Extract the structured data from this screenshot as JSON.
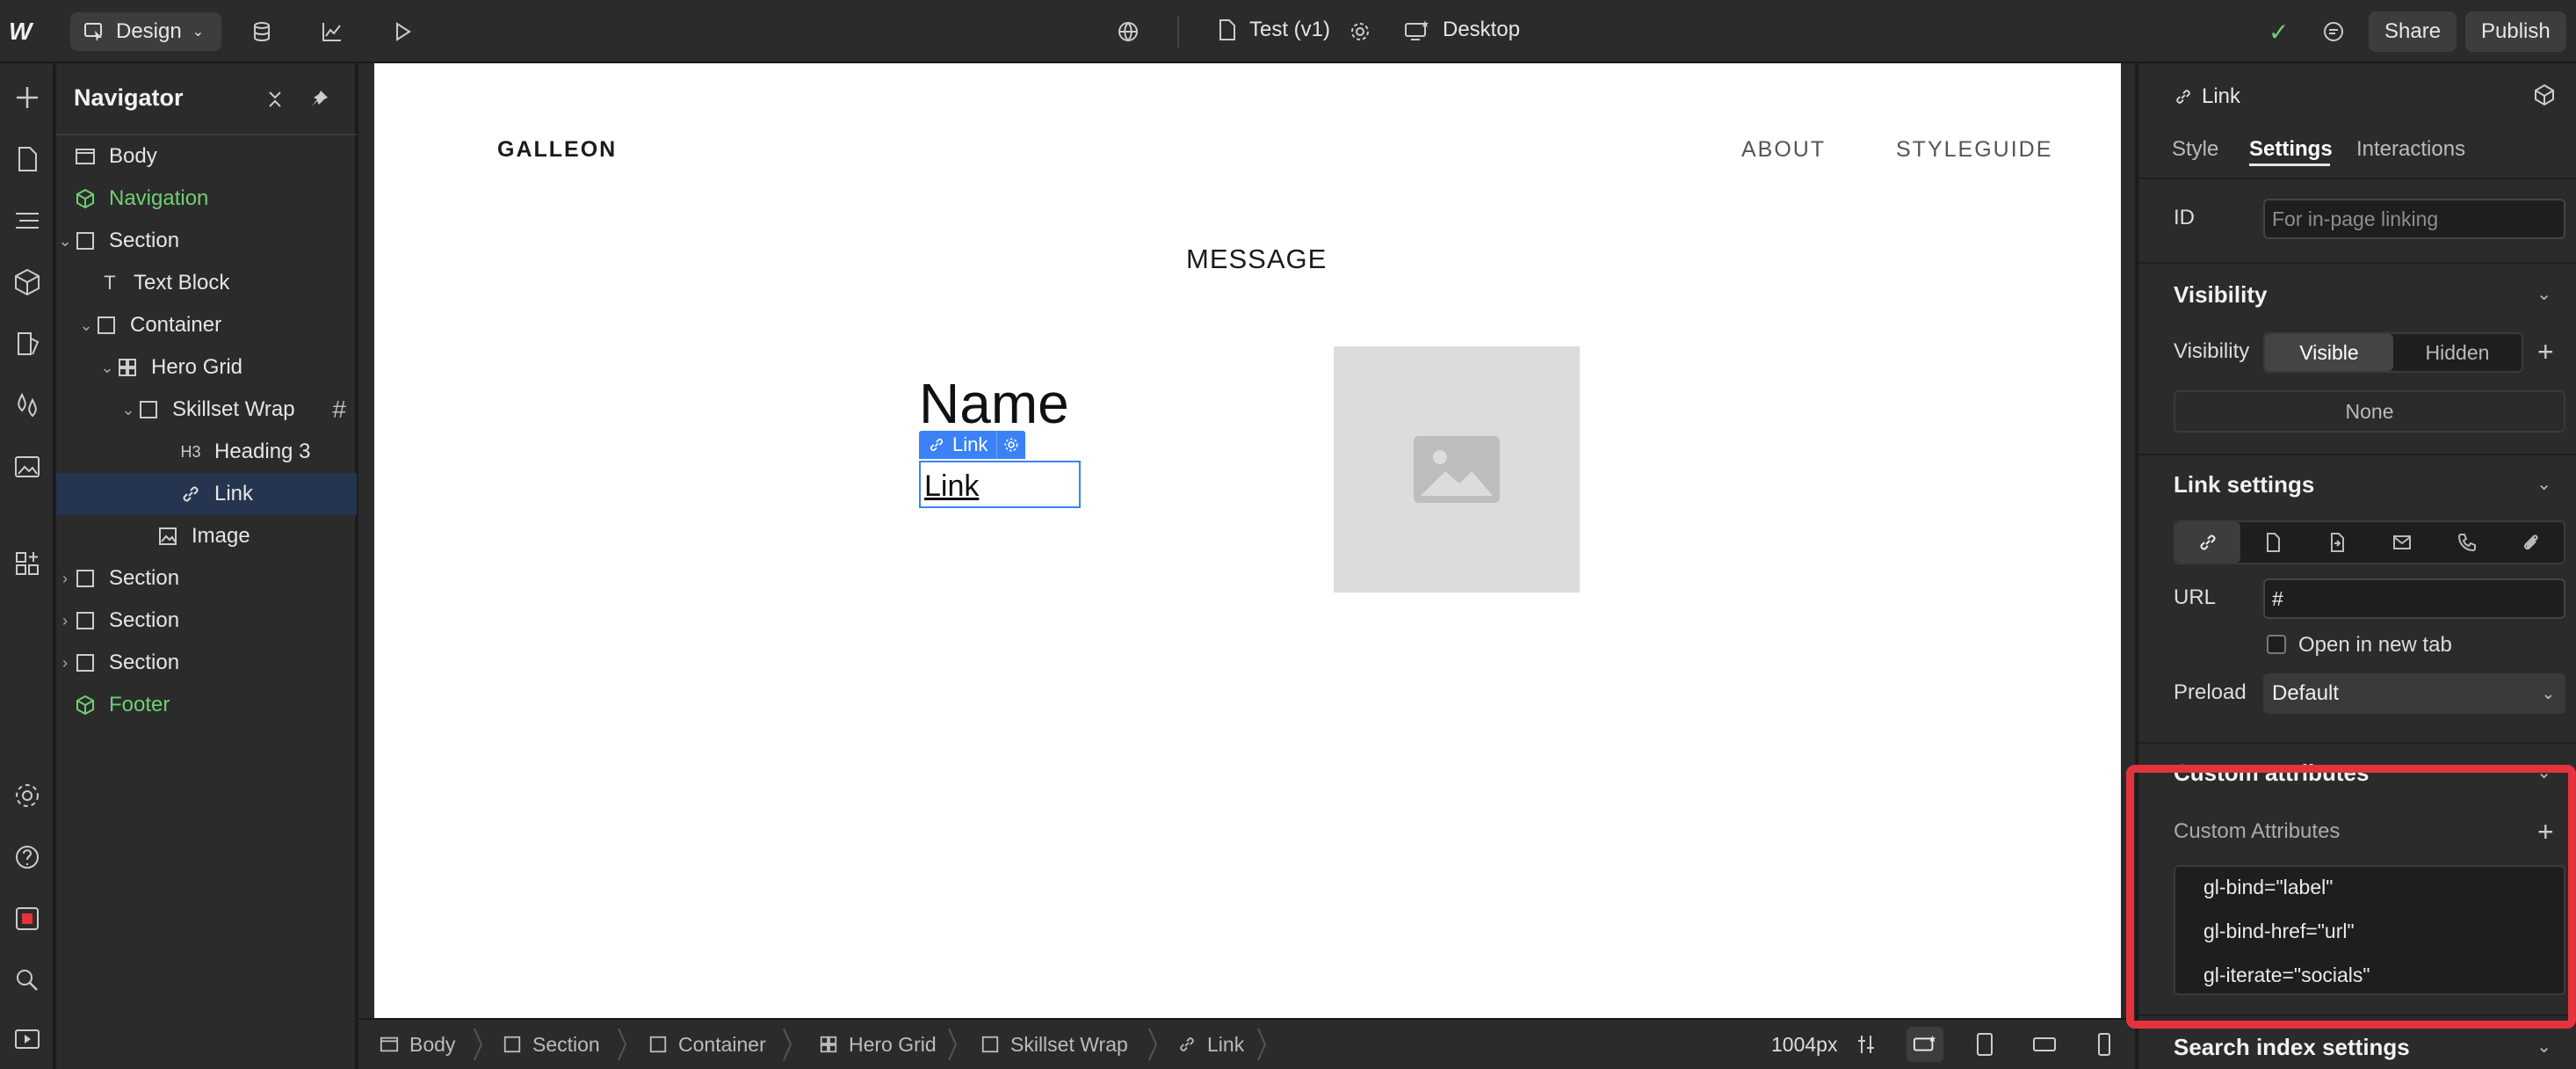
{
  "topbar": {
    "logo": "W",
    "mode_label": "Design",
    "page_name": "Test (v1)",
    "breakpoint_label": "Desktop",
    "share_label": "Share",
    "publish_label": "Publish"
  },
  "navigator": {
    "title": "Navigator",
    "items": [
      {
        "label": "Body",
        "icon": "body-icon"
      },
      {
        "label": "Navigation",
        "icon": "component-icon",
        "green": true
      },
      {
        "label": "Section",
        "icon": "box-icon"
      },
      {
        "label": "Text Block",
        "icon": "text-icon"
      },
      {
        "label": "Container",
        "icon": "box-icon"
      },
      {
        "label": "Hero Grid",
        "icon": "grid-icon"
      },
      {
        "label": "Skillset Wrap",
        "icon": "box-icon",
        "suffix": "#"
      },
      {
        "label": "Heading 3",
        "icon": "heading-icon",
        "icon_text": "H3"
      },
      {
        "label": "Link",
        "icon": "link-icon",
        "selected": true
      },
      {
        "label": "Image",
        "icon": "image-icon"
      },
      {
        "label": "Section",
        "icon": "box-icon"
      },
      {
        "label": "Section",
        "icon": "box-icon"
      },
      {
        "label": "Section",
        "icon": "box-icon"
      },
      {
        "label": "Footer",
        "icon": "component-icon",
        "green": true
      }
    ]
  },
  "canvas": {
    "site_logo": "GALLEON",
    "nav_links": [
      "ABOUT",
      "STYLEGUIDE"
    ],
    "message": "MESSAGE",
    "name_heading": "Name",
    "link_badge": "Link",
    "link_text": "Link"
  },
  "breadcrumb": {
    "items": [
      "Body",
      "Section",
      "Container",
      "Hero Grid",
      "Skillset Wrap",
      "Link"
    ],
    "width_readout": "1004px"
  },
  "panel": {
    "element_title": "Link",
    "tabs": [
      "Style",
      "Settings",
      "Interactions"
    ],
    "active_tab": "Settings",
    "id_label": "ID",
    "id_placeholder": "For in-page linking",
    "visibility_section": "Visibility",
    "visibility_label": "Visibility",
    "visible_option": "Visible",
    "hidden_option": "Hidden",
    "none_label": "None",
    "link_settings_section": "Link settings",
    "url_label": "URL",
    "url_value": "#",
    "new_tab_label": "Open in new tab",
    "preload_label": "Preload",
    "preload_value": "Default",
    "custom_attributes_section": "Custom attributes",
    "custom_attributes_label": "Custom Attributes",
    "attributes": [
      "gl-bind=\"label\"",
      "gl-bind-href=\"url\"",
      "gl-iterate=\"socials\""
    ],
    "search_index_section": "Search index settings"
  },
  "colors": {
    "accent": "#3b82f6",
    "highlight": "#e5333d",
    "component_green": "#6fcf72",
    "selected_row": "#26354f"
  }
}
